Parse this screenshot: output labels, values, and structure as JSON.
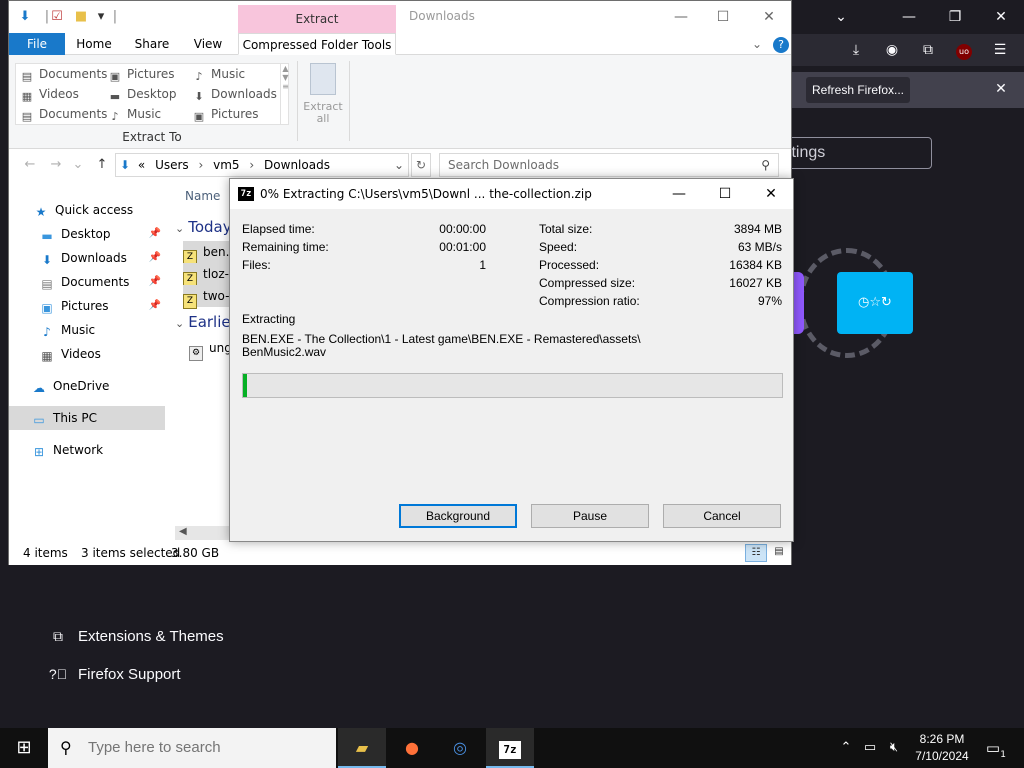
{
  "firefox": {
    "notification": {
      "refresh_label": "Refresh Firefox..."
    },
    "search_partial": "ttings",
    "tile_icons": "◷☆↻",
    "links": [
      {
        "icon": "puzzle-icon",
        "label": "Extensions & Themes"
      },
      {
        "icon": "help-icon",
        "label": "Firefox Support"
      }
    ],
    "toolbar_badge": "uo"
  },
  "explorer": {
    "title": "Downloads",
    "context_tab": "Extract",
    "ribbon_tabs": [
      "File",
      "Home",
      "Share",
      "View",
      "Compressed Folder Tools"
    ],
    "gallery": [
      [
        "Documents",
        "Pictures",
        "Music"
      ],
      [
        "Videos",
        "Desktop",
        "Downloads"
      ],
      [
        "Documents",
        "Music",
        "Pictures"
      ]
    ],
    "group_label": "Extract To",
    "extract_all": [
      "Extract",
      "all"
    ],
    "address": {
      "sep": "«",
      "parts": [
        "Users",
        "vm5",
        "Downloads"
      ]
    },
    "search_placeholder": "Search Downloads",
    "nav": [
      {
        "label": "Quick access",
        "icon": "star-icon"
      },
      {
        "label": "Desktop",
        "icon": "desktop-icon",
        "pinned": true
      },
      {
        "label": "Downloads",
        "icon": "download-icon",
        "pinned": true
      },
      {
        "label": "Documents",
        "icon": "document-icon",
        "pinned": true
      },
      {
        "label": "Pictures",
        "icon": "pictures-icon",
        "pinned": true
      },
      {
        "label": "Music",
        "icon": "music-icon"
      },
      {
        "label": "Videos",
        "icon": "videos-icon"
      },
      {
        "label": "OneDrive",
        "icon": "cloud-icon"
      },
      {
        "label": "This PC",
        "icon": "computer-icon"
      },
      {
        "label": "Network",
        "icon": "network-icon"
      }
    ],
    "column_name": "Name",
    "groups": [
      {
        "label": "Today",
        "items": [
          "ben.",
          "tloz-",
          "two-"
        ]
      },
      {
        "label": "Earlier",
        "items": [
          "ungo"
        ]
      }
    ],
    "status": {
      "items": "4 items",
      "selected": "3 items selected",
      "size": "3.80 GB"
    }
  },
  "sevenzip": {
    "title": "0% Extracting C:\\Users\\vm5\\Downl ... the-collection.zip",
    "left_stats": [
      {
        "label": "Elapsed time:",
        "value": "00:00:00"
      },
      {
        "label": "Remaining time:",
        "value": "00:01:00"
      },
      {
        "label": "Files:",
        "value": "1"
      }
    ],
    "right_stats": [
      {
        "label": "Total size:",
        "value": "3894 MB"
      },
      {
        "label": "Speed:",
        "value": "63 MB/s"
      },
      {
        "label": "Processed:",
        "value": "16384 KB"
      },
      {
        "label": "Compressed size:",
        "value": "16027 KB"
      },
      {
        "label": "Compression ratio:",
        "value": "97%"
      }
    ],
    "extracting_label": "Extracting",
    "path_line1": "BEN.EXE - The Collection\\1 - Latest game\\BEN.EXE - Remastered\\assets\\",
    "path_line2": "BenMusic2.wav",
    "progress": 0.007,
    "buttons": {
      "background": "Background",
      "pause": "Pause",
      "cancel": "Cancel"
    }
  },
  "taskbar": {
    "search_placeholder": "Type here to search",
    "time": "8:26 PM",
    "date": "7/10/2024",
    "notification_count": "1",
    "sevenzip_label": "7z"
  }
}
